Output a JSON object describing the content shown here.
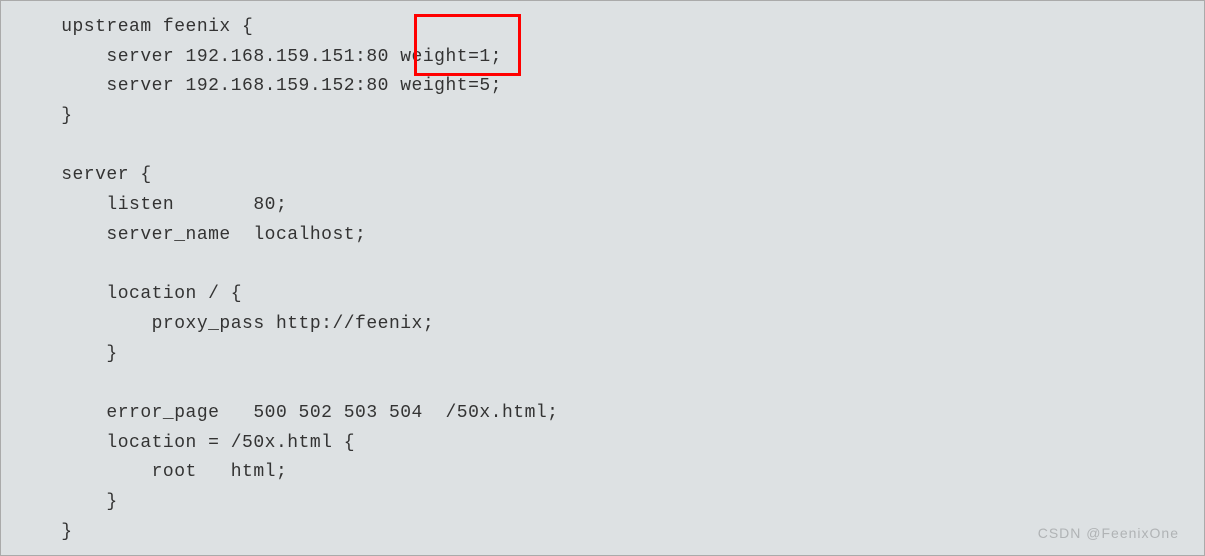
{
  "code": {
    "line1": "    upstream feenix {",
    "line2": "        server 192.168.159.151:80 weight=1;",
    "line3": "        server 192.168.159.152:80 weight=5;",
    "line4": "    }",
    "line5": "",
    "line6": "    server {",
    "line7": "        listen       80;",
    "line8": "        server_name  localhost;",
    "line9": "",
    "line10": "        location / {",
    "line11": "            proxy_pass http://feenix;",
    "line12": "        }",
    "line13": "",
    "line14": "        error_page   500 502 503 504  /50x.html;",
    "line15": "        location = /50x.html {",
    "line16": "            root   html;",
    "line17": "        }",
    "line18": "    }"
  },
  "highlight": {
    "top": "13",
    "left": "413",
    "width": "107",
    "height": "62"
  },
  "watermark": "CSDN @FeenixOne"
}
